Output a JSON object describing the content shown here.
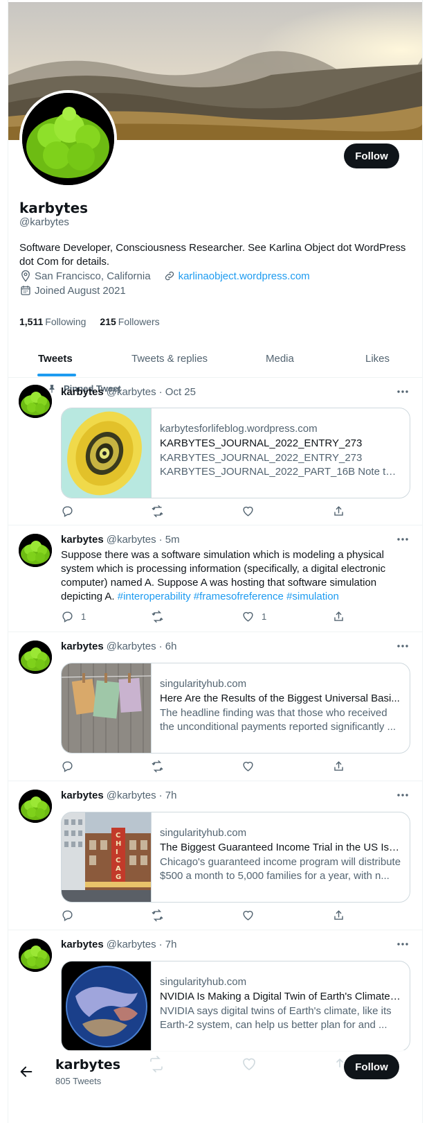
{
  "profile": {
    "name": "karbytes",
    "handle": "@karbytes",
    "bio": "Software Developer, Consciousness Researcher. See Karlina Object dot WordPress dot Com for details.",
    "location": "San Francisco, California",
    "website": "karlinaobject.wordpress.com",
    "joined": "Joined August 2021",
    "following_count": "1,511",
    "following_label": "Following",
    "followers_count": "215",
    "followers_label": "Followers",
    "follow_button": "Follow"
  },
  "tabs": [
    {
      "label": "Tweets",
      "active": true
    },
    {
      "label": "Tweets & replies",
      "active": false
    },
    {
      "label": "Media",
      "active": false
    },
    {
      "label": "Likes",
      "active": false
    }
  ],
  "tweets": [
    {
      "pinned_label": "Pinned Tweet",
      "name": "karbytes",
      "handle": "@karbytes",
      "time": "· Oct 25",
      "card": {
        "domain": "karbytesforlifeblog.wordpress.com",
        "title": "KARBYTES_JOURNAL_2022_ENTRY_273",
        "description": "KARBYTES_JOURNAL_2022_ENTRY_273 KARBYTES_JOURNAL_2022_PART_16B Note that ..."
      },
      "replies": "",
      "retweets": "",
      "likes": ""
    },
    {
      "name": "karbytes",
      "handle": "@karbytes",
      "time": "· 5m",
      "text": "Suppose there was a software simulation which is modeling a physical system which is processing information (specifically, a digital electronic computer) named A. Suppose A was hosting that software simulation depicting A.",
      "hashtags": "#interoperability #framesofreference #simulation",
      "replies": "1",
      "retweets": "",
      "likes": "1"
    },
    {
      "name": "karbytes",
      "handle": "@karbytes",
      "time": "· 6h",
      "card": {
        "domain": "singularityhub.com",
        "title": "Here Are the Results of the Biggest Universal Basi...",
        "description": "The headline finding was that those who received the unconditional payments reported significantly ..."
      },
      "replies": "",
      "retweets": "",
      "likes": ""
    },
    {
      "name": "karbytes",
      "handle": "@karbytes",
      "time": "· 7h",
      "card": {
        "domain": "singularityhub.com",
        "title": "The Biggest Guaranteed Income Trial in the US Is L...",
        "description": "Chicago's guaranteed income program will distribute $500 a month to 5,000 families for a year, with n..."
      },
      "replies": "",
      "retweets": "",
      "likes": ""
    },
    {
      "name": "karbytes",
      "handle": "@karbytes",
      "time": "· 7h",
      "card": {
        "domain": "singularityhub.com",
        "title": "NVIDIA Is Making a Digital Twin of Earth's Climate....",
        "description": "NVIDIA says digital twins of Earth's climate, like its Earth-2 system, can help us better plan for and ..."
      }
    }
  ],
  "sticky_header": {
    "name": "karbytes",
    "tweet_count": "805 Tweets",
    "follow_button": "Follow"
  },
  "colors": {
    "accent": "#1d9bf0",
    "text": "#0f1419",
    "muted": "#536471",
    "border": "#eff3f4",
    "avatar_green": "#7cd11a"
  }
}
